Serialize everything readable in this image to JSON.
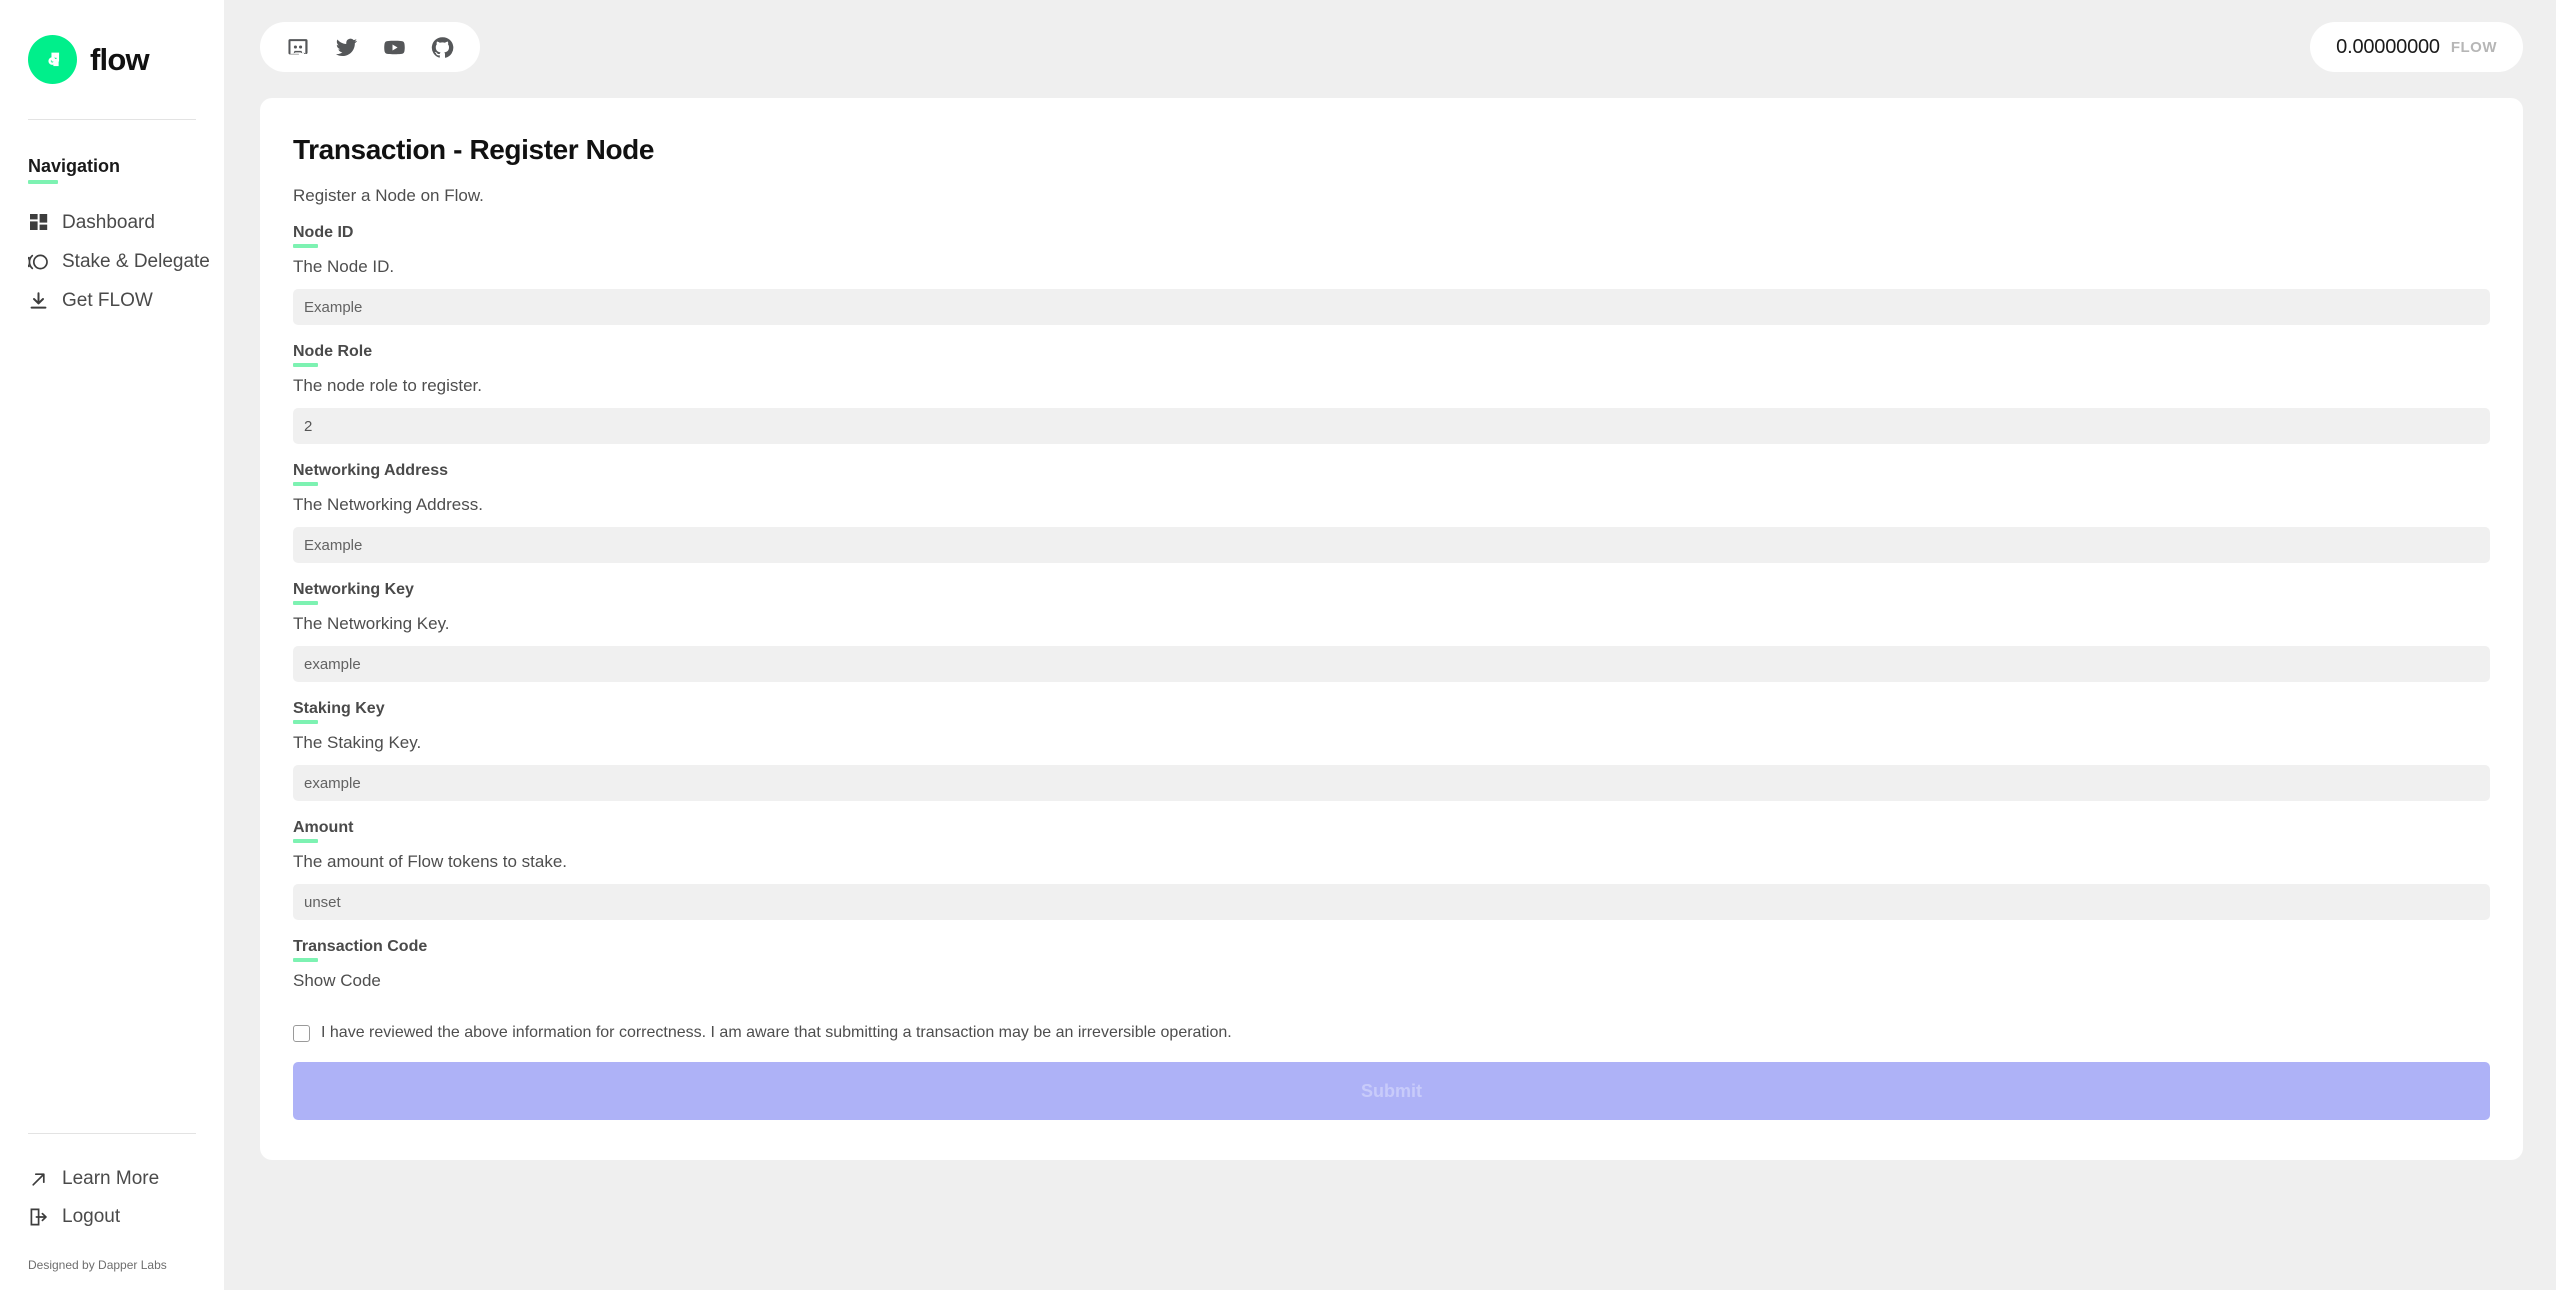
{
  "brand": {
    "name": "flow",
    "logo_icon": "flow-logo-icon",
    "accent_green": "#00ef8b",
    "underline_green": "#7df2b2"
  },
  "sidebar": {
    "nav_title": "Navigation",
    "items": [
      {
        "label": "Dashboard",
        "icon": "dashboard-grid-icon"
      },
      {
        "label": "Stake & Delegate",
        "icon": "stake-delegate-icon"
      },
      {
        "label": "Get FLOW",
        "icon": "download-icon"
      }
    ],
    "footer_items": [
      {
        "label": "Learn More",
        "icon": "external-link-arrow-icon"
      },
      {
        "label": "Logout",
        "icon": "logout-icon"
      }
    ],
    "credit": "Designed by Dapper Labs"
  },
  "topbar": {
    "socials": [
      {
        "name": "discord-icon",
        "label": "Discord"
      },
      {
        "name": "twitter-icon",
        "label": "Twitter"
      },
      {
        "name": "youtube-icon",
        "label": "YouTube"
      },
      {
        "name": "github-icon",
        "label": "GitHub"
      }
    ],
    "balance": {
      "amount": "0.00000000",
      "unit": "FLOW"
    }
  },
  "main": {
    "title": "Transaction - Register Node",
    "subtitle": "Register a Node on Flow.",
    "fields": [
      {
        "label": "Node ID",
        "help": "The Node ID.",
        "value": "",
        "placeholder": "Example"
      },
      {
        "label": "Node Role",
        "help": "The node role to register.",
        "value": "2",
        "placeholder": "2"
      },
      {
        "label": "Networking Address",
        "help": "The Networking Address.",
        "value": "",
        "placeholder": "Example"
      },
      {
        "label": "Networking Key",
        "help": "The Networking Key.",
        "value": "",
        "placeholder": "example"
      },
      {
        "label": "Staking Key",
        "help": "The Staking Key.",
        "value": "",
        "placeholder": "example"
      },
      {
        "label": "Amount",
        "help": "The amount of Flow tokens to stake.",
        "value": "",
        "placeholder": "unset"
      }
    ],
    "transaction_code": {
      "label": "Transaction Code",
      "toggle_label": "Show Code"
    },
    "consent": {
      "checked": false,
      "text": "I have reviewed the above information for correctness. I am aware that submitting a transaction may be an irreversible operation."
    },
    "submit": {
      "label": "Submit",
      "disabled": true,
      "color": "#aeb2f7"
    }
  }
}
